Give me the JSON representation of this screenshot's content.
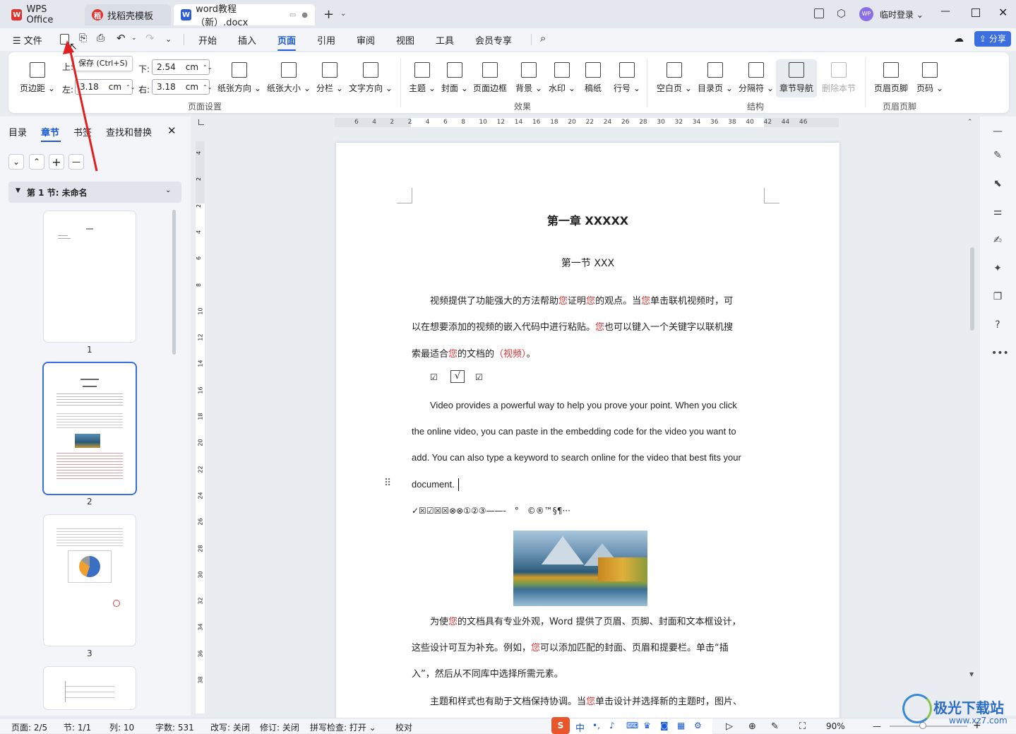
{
  "titlebar": {
    "tabs": [
      {
        "label": "WPS Office",
        "icon": "wps-logo-icon"
      },
      {
        "label": "找稻壳模板",
        "icon": "docer-logo-icon"
      },
      {
        "label": "word教程（新）.docx",
        "icon": "word-doc-icon"
      }
    ],
    "avatar_text": "WP",
    "login_label": "临时登录"
  },
  "menubar": {
    "file_label": "文件",
    "items": [
      "开始",
      "插入",
      "页面",
      "引用",
      "审阅",
      "视图",
      "工具",
      "会员专享"
    ],
    "active": "页面",
    "share_label": "分享"
  },
  "tooltip": "保存 (Ctrl+S)",
  "ribbon": {
    "margins_label": "页边距",
    "top_label": "上:",
    "bottom_label": "下:",
    "bottom_value": "2.54",
    "left_label": "左:",
    "left_value": "3.18",
    "right_label": "右:",
    "right_value": "3.18",
    "unit": "cm",
    "orientation_label": "纸张方向",
    "size_label": "纸张大小",
    "columns_label": "分栏",
    "text_direction_label": "文字方向",
    "theme_label": "主题",
    "cover_label": "封面",
    "page_border_label": "页面边框",
    "background_label": "背景",
    "watermark_label": "水印",
    "manuscript_label": "稿纸",
    "line_numbers_label": "行号",
    "blank_page_label": "空白页",
    "toc_page_label": "目录页",
    "breaks_label": "分隔符",
    "section_nav_label": "章节导航",
    "delete_section_label": "删除本节",
    "header_footer_label": "页眉页脚",
    "page_number_label": "页码",
    "groups": [
      "页面设置",
      "效果",
      "结构",
      "页眉页脚"
    ]
  },
  "leftpanel": {
    "tabs": [
      "目录",
      "章节",
      "书签",
      "查找和替换"
    ],
    "active_tab": "章节",
    "section_title": "第 1 节: 未命名",
    "pages": [
      "1",
      "2",
      "3"
    ]
  },
  "ruler": {
    "h_ticks": [
      "6",
      "4",
      "2",
      "2",
      "4",
      "6",
      "8",
      "10",
      "12",
      "14",
      "16",
      "18",
      "20",
      "22",
      "24",
      "26",
      "28",
      "30",
      "32",
      "34",
      "36",
      "38",
      "40",
      "42",
      "44",
      "46"
    ],
    "v_ticks": [
      "4",
      "2",
      "2",
      "4",
      "6",
      "8",
      "10",
      "12",
      "14",
      "16",
      "18",
      "20",
      "22",
      "24",
      "26",
      "28",
      "30",
      "32",
      "34",
      "36",
      "38"
    ]
  },
  "document": {
    "chapter_title": "第一章 XXXXX",
    "section_title": "第一节 XXX",
    "para1": [
      {
        "t": "视频提供了功能强大的方法帮助"
      },
      {
        "t": "您",
        "red": true
      },
      {
        "t": "证明"
      },
      {
        "t": "您",
        "red": true
      },
      {
        "t": "的观点。当"
      },
      {
        "t": "您",
        "red": true
      },
      {
        "t": "单击联机视频时，可"
      }
    ],
    "para1_l2": [
      {
        "t": "以在想要添加的视频的嵌入代码中进行粘贴。"
      },
      {
        "t": "您",
        "red": true
      },
      {
        "t": "也可以键入一个关键字以联机搜"
      }
    ],
    "para1_l3": [
      {
        "t": "索最适合"
      },
      {
        "t": "您",
        "red": true
      },
      {
        "t": "的文档的"
      },
      {
        "t": "（视频）",
        "red": true
      },
      {
        "t": "。"
      }
    ],
    "checks": [
      "☑",
      "√",
      "☑"
    ],
    "en_l1": "Video provides a powerful way to help you prove your point. When you click",
    "en_l2": "the online video, you can paste in the embedding code for the video you want to",
    "en_l3": "add. You can also type a keyword to search online for the video that best fits your",
    "en_l4": "document.",
    "symbols": "✓☒☑☒☒⊗⊗①②③——-　°　©®™§¶···",
    "para3_l1": [
      {
        "t": "为使"
      },
      {
        "t": "您",
        "red": true
      },
      {
        "t": "的文档具有专业外观，Word 提供了页眉、页脚、封面和文本框设计，"
      }
    ],
    "para3_l2": [
      {
        "t": "这些设计可互为补充。例如，"
      },
      {
        "t": "您",
        "red": true
      },
      {
        "t": "可以添加匹配的封面、页眉和提要栏。单击“插"
      }
    ],
    "para3_l3": [
      {
        "t": "入”，然后从不同库中选择所需元素。"
      }
    ],
    "para4_l1": [
      {
        "t": "主题和样式也有助于文档保持协调。当"
      },
      {
        "t": "您",
        "red": true
      },
      {
        "t": "单击设计并选择新的主题时，图片、"
      }
    ]
  },
  "status": {
    "page": "页面: 2/5",
    "section": "节: 1/1",
    "column": "列: 10",
    "words": "字数: 531",
    "revise": "改写: 关闭",
    "track": "修订: 关闭",
    "spell": "拼写检查: 打开",
    "proof": "校对",
    "zoom": "90%"
  },
  "watermark_site": "极光下载站",
  "watermark_url": "www.xz7.com",
  "colors": {
    "accent": "#1a5ad7",
    "red": "#e03030",
    "share_bg": "#3b6fe0"
  }
}
